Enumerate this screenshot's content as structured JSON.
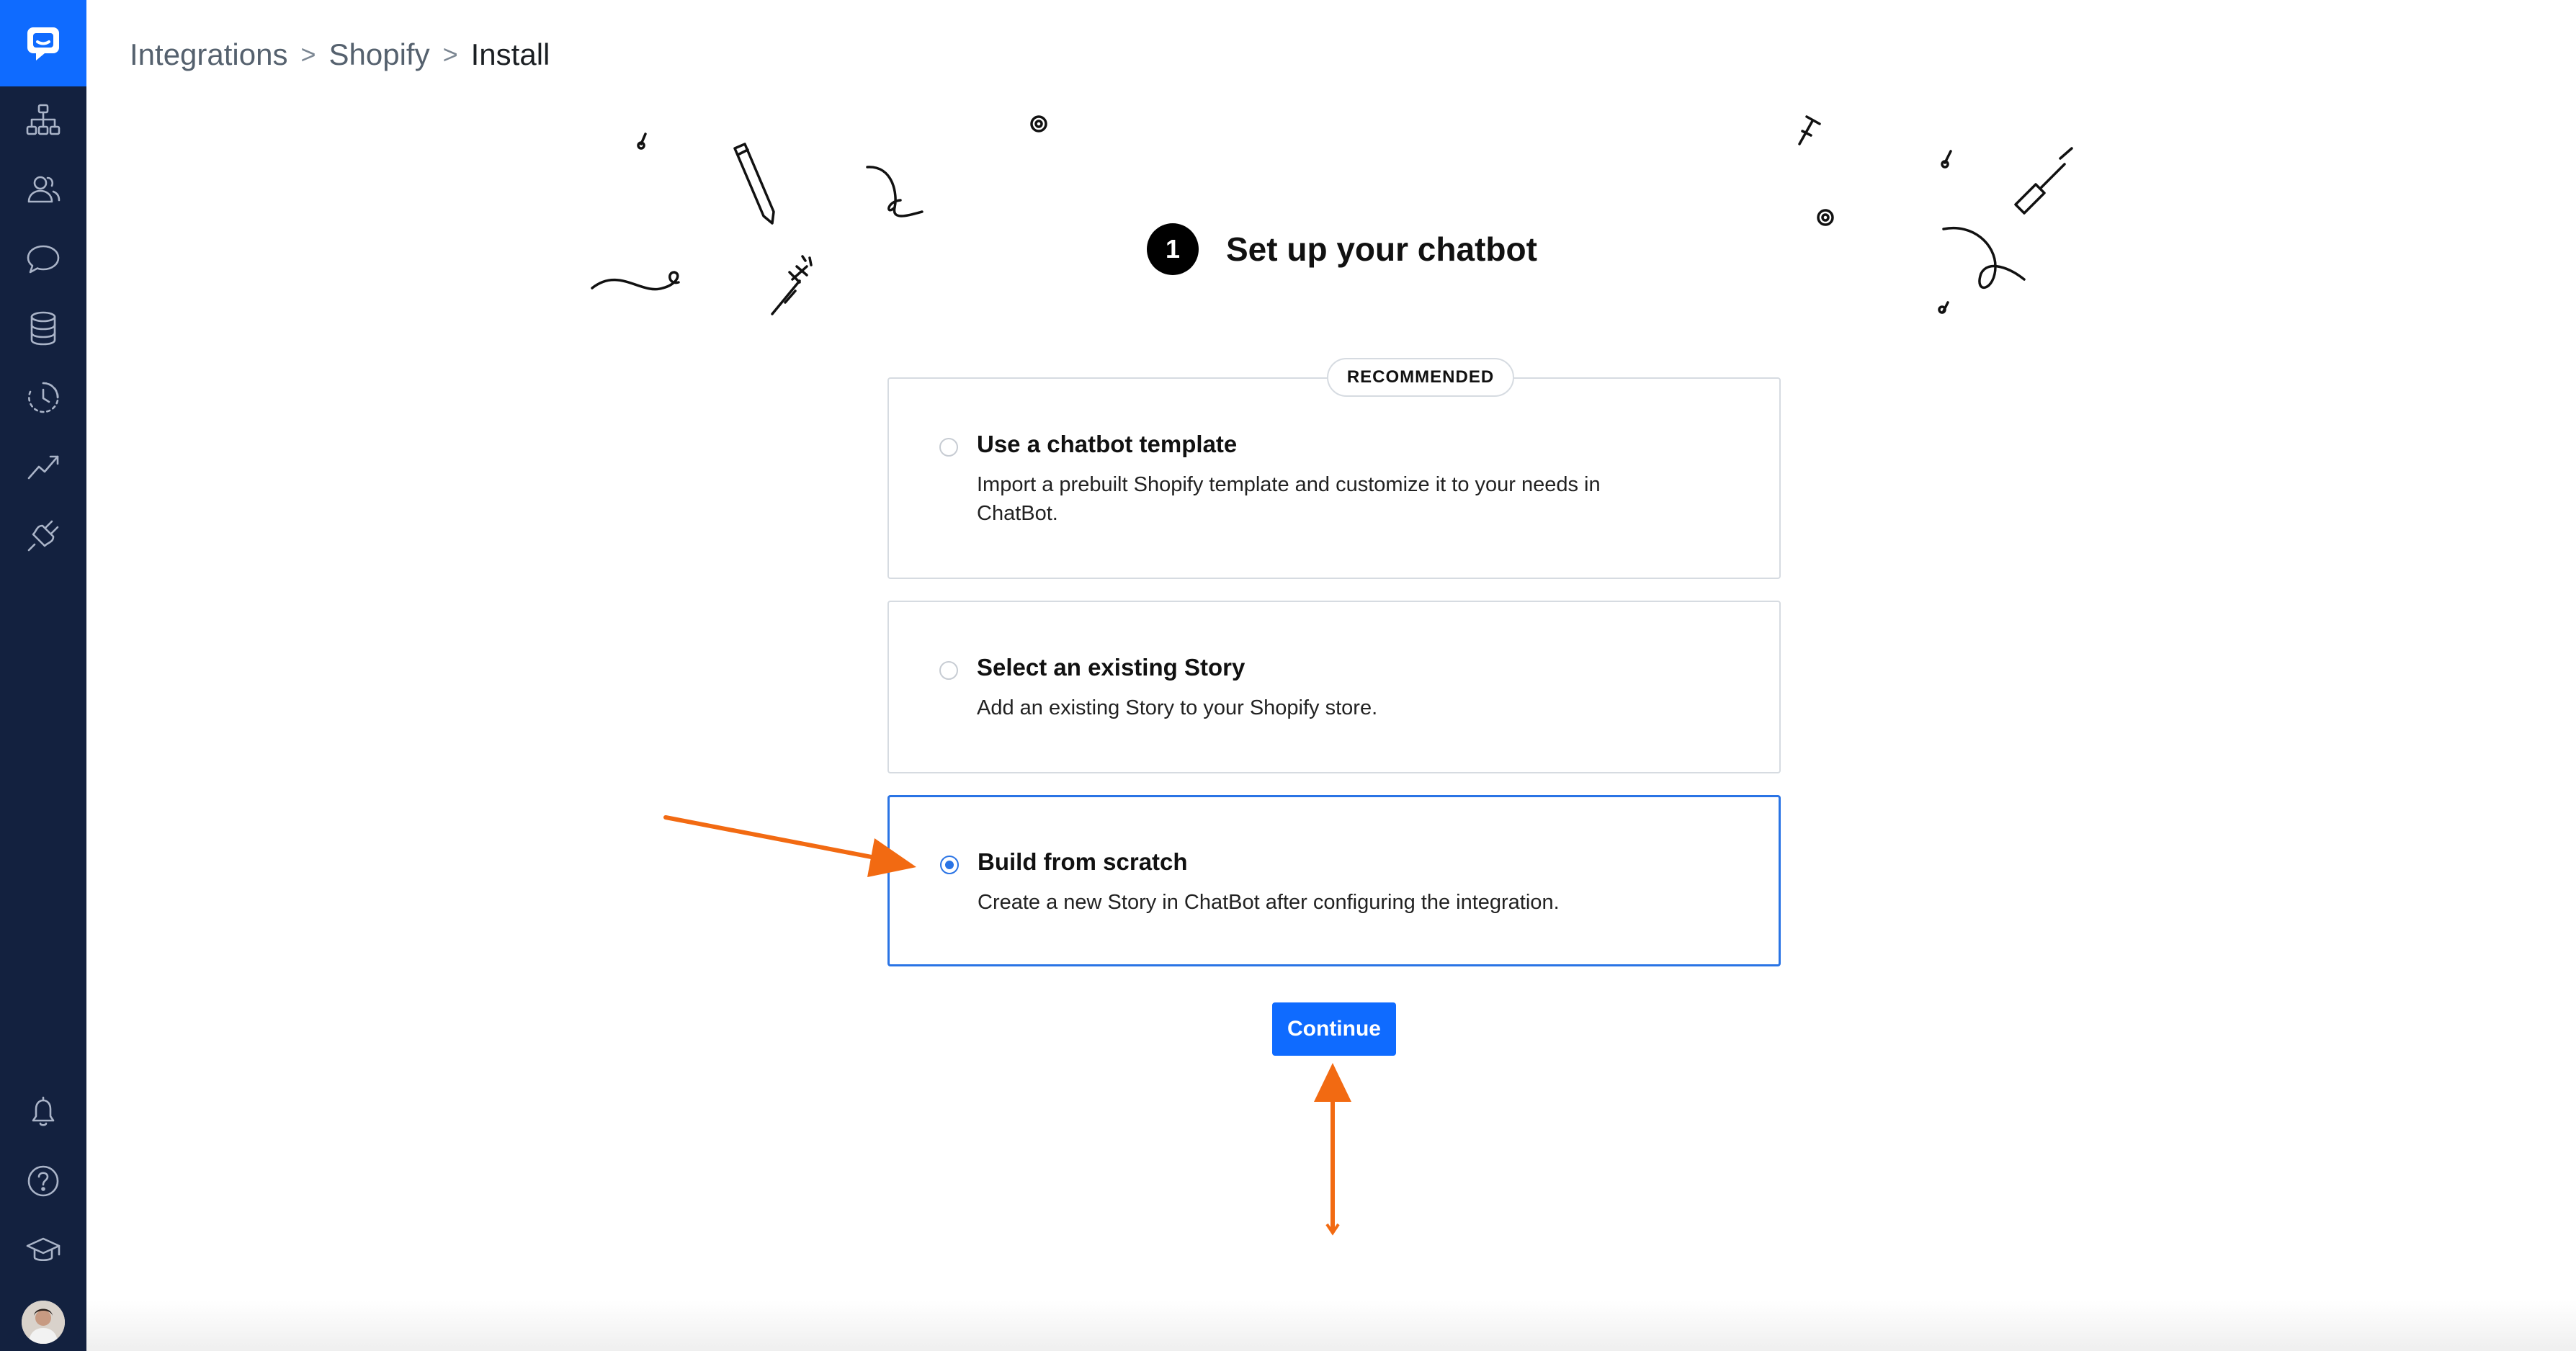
{
  "app": {
    "accent_color": "#0f6bff",
    "sidebar_color": "#13213f"
  },
  "sidebar": {
    "top_items": [
      {
        "icon": "sitemap-icon"
      },
      {
        "icon": "users-icon"
      },
      {
        "icon": "chat-bubble-icon"
      },
      {
        "icon": "database-icon"
      },
      {
        "icon": "clock-icon"
      },
      {
        "icon": "trend-icon"
      },
      {
        "icon": "plug-icon"
      }
    ],
    "bottom_items": [
      {
        "icon": "bell-icon"
      },
      {
        "icon": "help-icon"
      },
      {
        "icon": "academy-icon"
      }
    ]
  },
  "breadcrumb": {
    "items": [
      "Integrations",
      "Shopify",
      "Install"
    ],
    "separator": ">"
  },
  "setup": {
    "step_number": "1",
    "title": "Set up your chatbot",
    "recommended_badge": "RECOMMENDED",
    "options": [
      {
        "title": "Use a chatbot template",
        "description": "Import a prebuilt Shopify template and customize it to your needs in ChatBot.",
        "selected": false
      },
      {
        "title": "Select an existing Story",
        "description": "Add an existing Story to your Shopify store.",
        "selected": false
      },
      {
        "title": "Build from scratch",
        "description": "Create a new Story in ChatBot after configuring the integration.",
        "selected": true
      }
    ],
    "continue_label": "Continue"
  },
  "annotations": {
    "arrow_color": "#f26a12"
  }
}
